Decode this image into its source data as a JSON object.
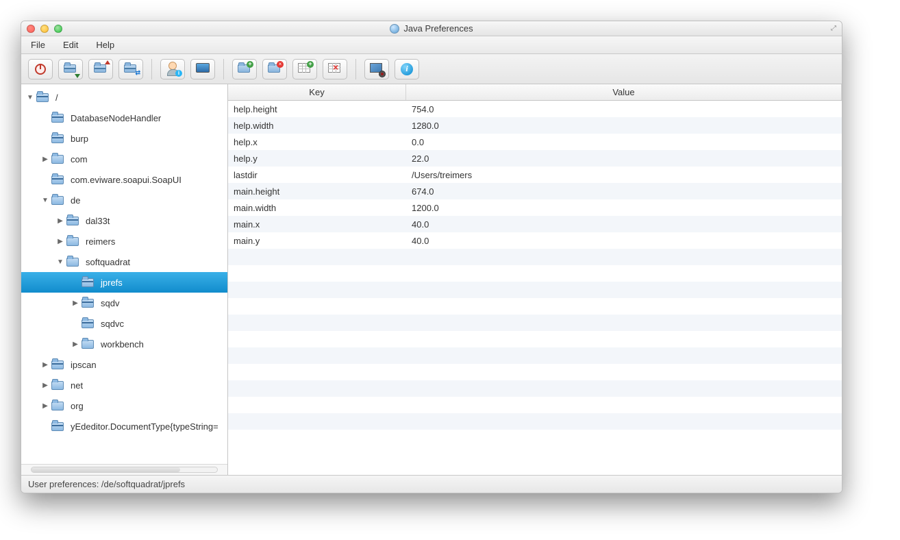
{
  "window": {
    "title": "Java Preferences"
  },
  "menubar": {
    "file": "File",
    "edit": "Edit",
    "help": "Help"
  },
  "toolbar": {
    "btn_power": "power",
    "btn_import": "import",
    "btn_export": "export",
    "btn_swap": "swap",
    "btn_user": "user-info",
    "btn_system": "system",
    "btn_new_folder": "new-folder",
    "btn_del_folder": "delete-folder",
    "btn_new_key": "new-key",
    "btn_del_key": "delete-key",
    "btn_settings": "settings",
    "btn_info": "info"
  },
  "tree": {
    "root": "/",
    "items": [
      {
        "indent": 0,
        "arrow": "down",
        "icon": "stripe",
        "label": "/"
      },
      {
        "indent": 1,
        "arrow": "",
        "icon": "stripe",
        "label": "DatabaseNodeHandler"
      },
      {
        "indent": 1,
        "arrow": "",
        "icon": "stripe",
        "label": "burp"
      },
      {
        "indent": 1,
        "arrow": "right",
        "icon": "plain",
        "label": "com"
      },
      {
        "indent": 1,
        "arrow": "",
        "icon": "stripe",
        "label": "com.eviware.soapui.SoapUI"
      },
      {
        "indent": 1,
        "arrow": "down",
        "icon": "plain",
        "label": "de"
      },
      {
        "indent": 2,
        "arrow": "right",
        "icon": "stripe",
        "label": "dal33t"
      },
      {
        "indent": 2,
        "arrow": "right",
        "icon": "plain",
        "label": "reimers"
      },
      {
        "indent": 2,
        "arrow": "down",
        "icon": "plain",
        "label": "softquadrat"
      },
      {
        "indent": 3,
        "arrow": "",
        "icon": "stripe",
        "label": "jprefs",
        "selected": true
      },
      {
        "indent": 3,
        "arrow": "right",
        "icon": "stripe",
        "label": "sqdv"
      },
      {
        "indent": 3,
        "arrow": "",
        "icon": "stripe",
        "label": "sqdvc"
      },
      {
        "indent": 3,
        "arrow": "right",
        "icon": "plain",
        "label": "workbench"
      },
      {
        "indent": 1,
        "arrow": "right",
        "icon": "stripe",
        "label": "ipscan"
      },
      {
        "indent": 1,
        "arrow": "right",
        "icon": "plain",
        "label": "net"
      },
      {
        "indent": 1,
        "arrow": "right",
        "icon": "plain",
        "label": "org"
      },
      {
        "indent": 1,
        "arrow": "",
        "icon": "stripe",
        "label": "yEdeditor.DocumentType{typeString="
      }
    ]
  },
  "table": {
    "headers": {
      "key": "Key",
      "value": "Value"
    },
    "rows": [
      {
        "key": "help.height",
        "value": "754.0"
      },
      {
        "key": "help.width",
        "value": "1280.0"
      },
      {
        "key": "help.x",
        "value": "0.0"
      },
      {
        "key": "help.y",
        "value": "22.0"
      },
      {
        "key": "lastdir",
        "value": "/Users/treimers"
      },
      {
        "key": "main.height",
        "value": "674.0"
      },
      {
        "key": "main.width",
        "value": "1200.0"
      },
      {
        "key": "main.x",
        "value": "40.0"
      },
      {
        "key": "main.y",
        "value": "40.0"
      }
    ]
  },
  "statusbar": {
    "text": "User preferences: /de/softquadrat/jprefs"
  }
}
